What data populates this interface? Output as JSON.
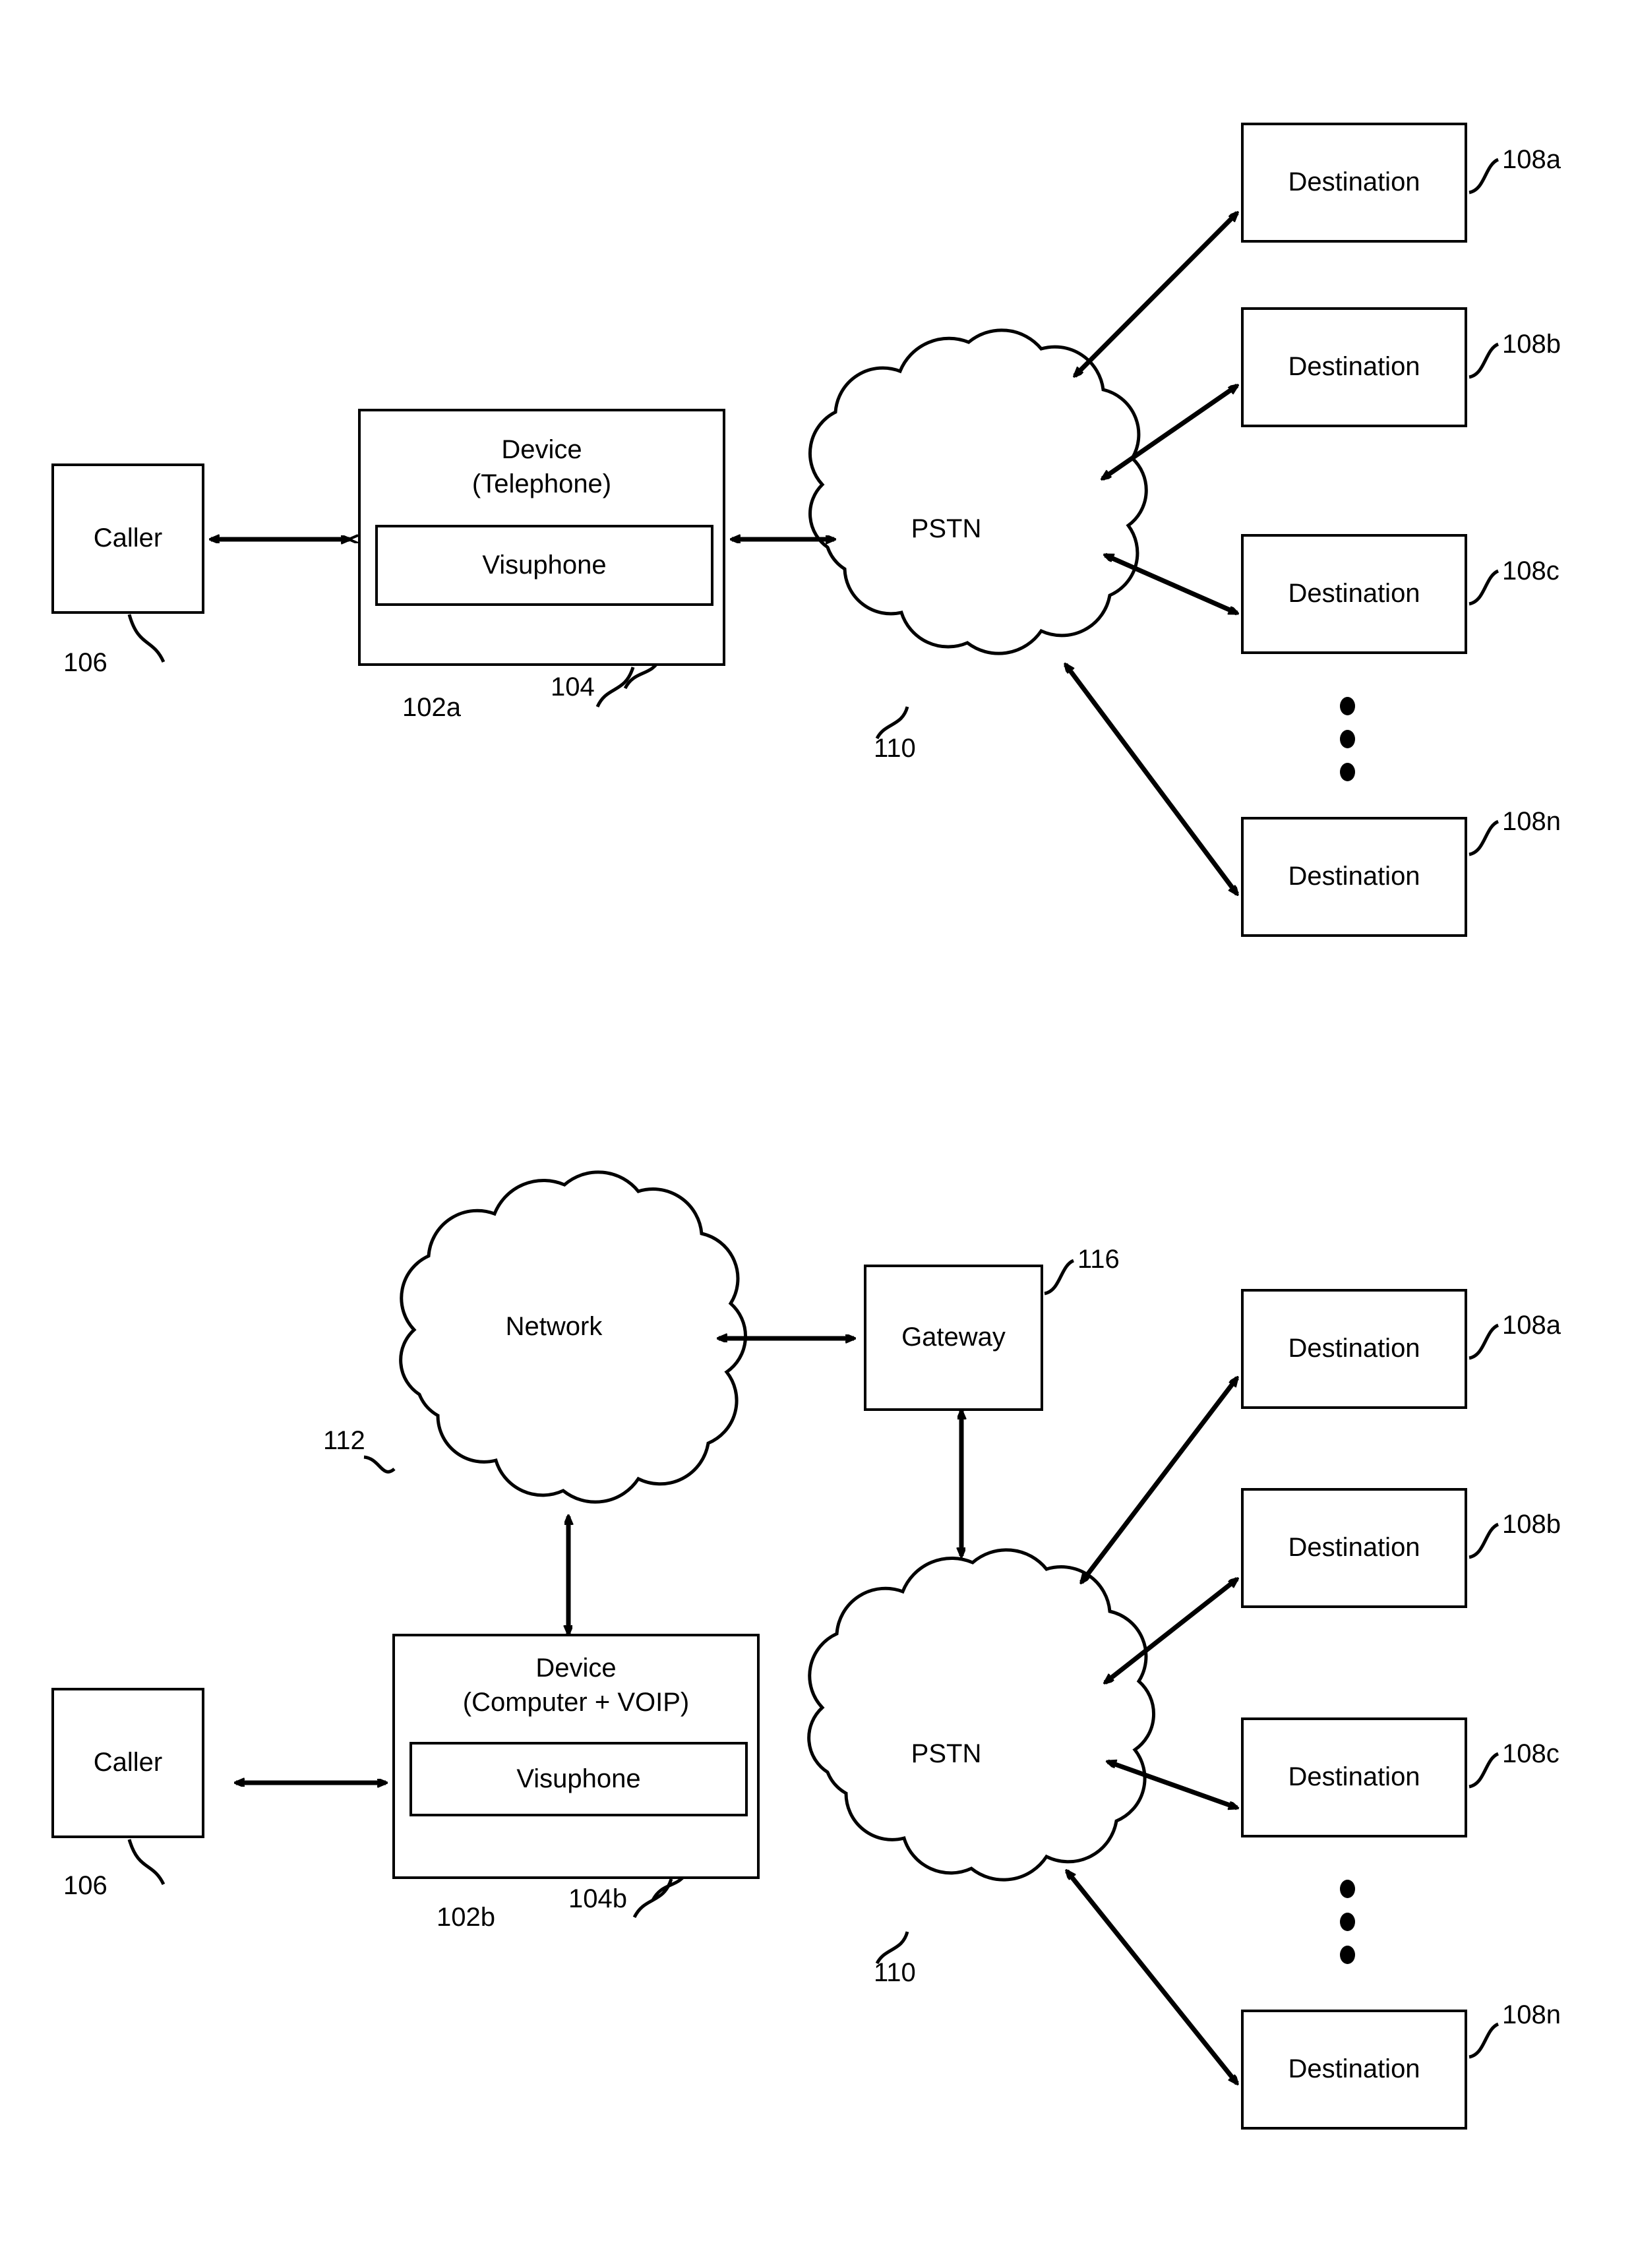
{
  "figure_top": {
    "caller": {
      "label": "Caller",
      "ref": "106"
    },
    "device": {
      "title": "Device\n(Telephone)",
      "ref": "102a",
      "module": {
        "label": "Visuphone",
        "ref": "104"
      }
    },
    "pstn": {
      "label": "PSTN",
      "ref": "110"
    },
    "destinations": [
      {
        "label": "Destination",
        "ref": "108a"
      },
      {
        "label": "Destination",
        "ref": "108b"
      },
      {
        "label": "Destination",
        "ref": "108c"
      },
      {
        "label": "Destination",
        "ref": "108n"
      }
    ],
    "ellipsis": "vertical-dots"
  },
  "figure_bottom": {
    "caller": {
      "label": "Caller",
      "ref": "106"
    },
    "device": {
      "title": "Device\n(Computer + VOIP)",
      "ref": "102b",
      "module": {
        "label": "Visuphone",
        "ref": "104b"
      }
    },
    "network": {
      "label": "Network",
      "ref": "112"
    },
    "gateway": {
      "label": "Gateway",
      "ref": "116"
    },
    "pstn": {
      "label": "PSTN",
      "ref": "110"
    },
    "destinations": [
      {
        "label": "Destination",
        "ref": "108a"
      },
      {
        "label": "Destination",
        "ref": "108b"
      },
      {
        "label": "Destination",
        "ref": "108c"
      },
      {
        "label": "Destination",
        "ref": "108n"
      }
    ],
    "ellipsis": "vertical-dots"
  },
  "style": {
    "stroke": "#000000",
    "background": "#ffffff"
  }
}
